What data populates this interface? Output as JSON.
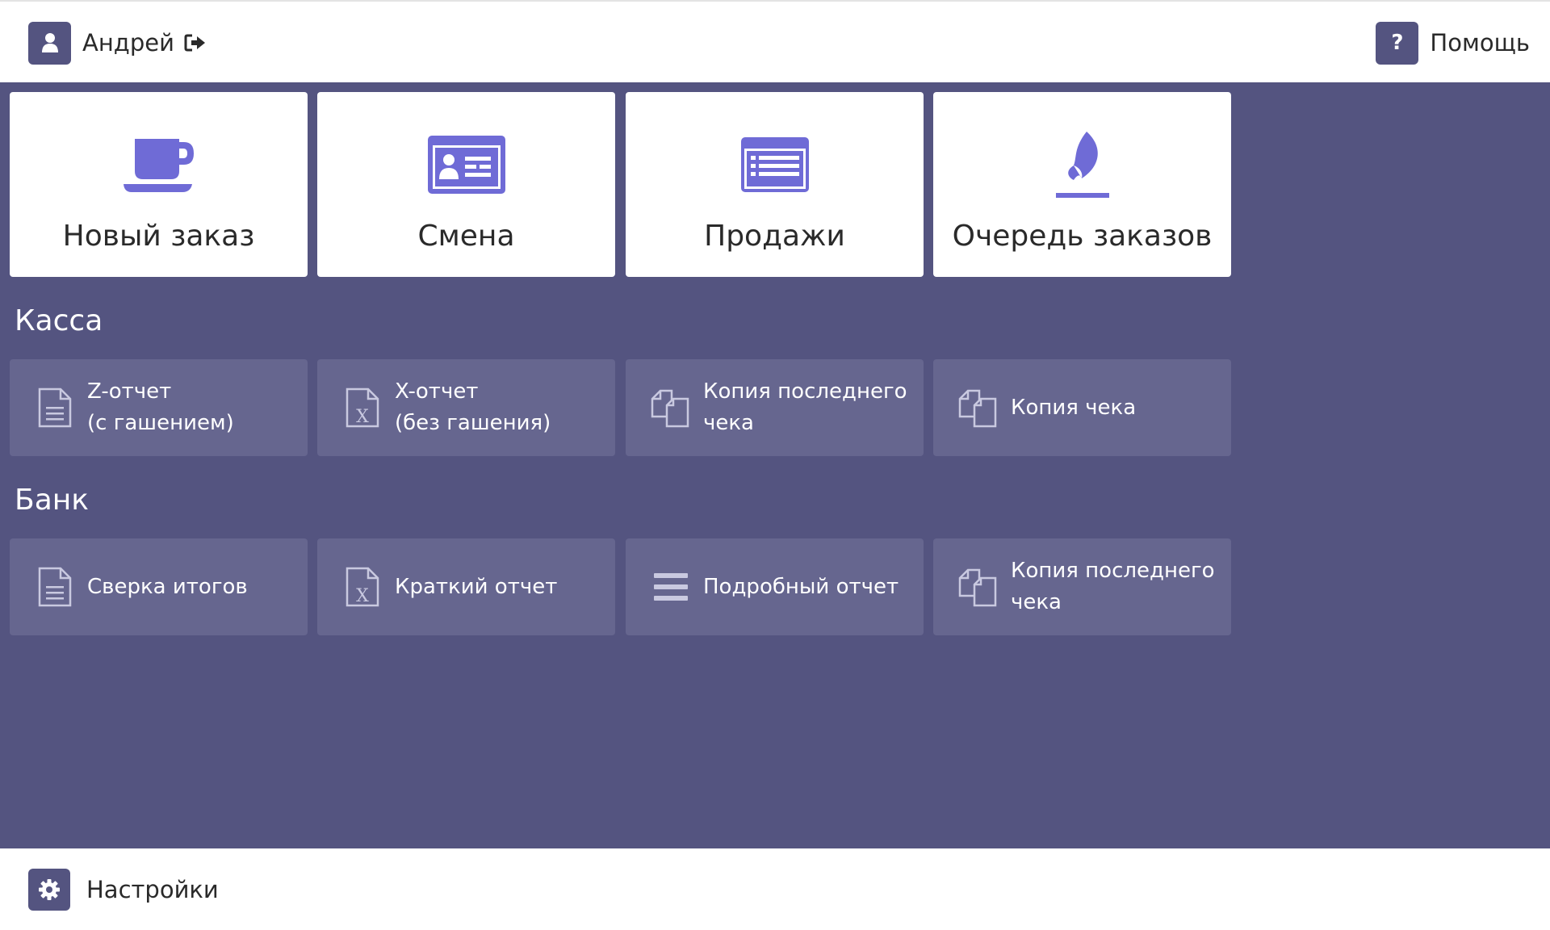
{
  "header": {
    "user_name": "Андрей",
    "help_label": "Помощь",
    "help_icon_glyph": "?"
  },
  "tiles": [
    {
      "label": "Новый заказ",
      "icon": "coffee-cup-icon"
    },
    {
      "label": "Смена",
      "icon": "id-card-icon"
    },
    {
      "label": "Продажи",
      "icon": "list-icon"
    },
    {
      "label": "Очередь заказов",
      "icon": "flame-icon"
    }
  ],
  "sections": {
    "kassa": {
      "title": "Касса",
      "actions": [
        {
          "label": "Z-отчет\n(с гашением)",
          "icon": "document-icon"
        },
        {
          "label": "X-отчет\n(без гашения)",
          "icon": "excel-file-icon"
        },
        {
          "label": "Копия последнего\nчека",
          "icon": "copy-icon"
        },
        {
          "label": "Копия чека",
          "icon": "copy-icon"
        }
      ]
    },
    "bank": {
      "title": "Банк",
      "actions": [
        {
          "label": "Сверка итогов",
          "icon": "document-icon"
        },
        {
          "label": "Краткий отчет",
          "icon": "excel-file-icon"
        },
        {
          "label": "Подробный отчет",
          "icon": "bars-icon"
        },
        {
          "label": "Копия последнего\nчека",
          "icon": "copy-icon"
        }
      ]
    }
  },
  "footer": {
    "settings_label": "Настройки"
  },
  "colors": {
    "brand": "#545480",
    "tile_icon": "#6f6bd6",
    "action_bg": "#66668f",
    "surface": "#ffffff"
  }
}
